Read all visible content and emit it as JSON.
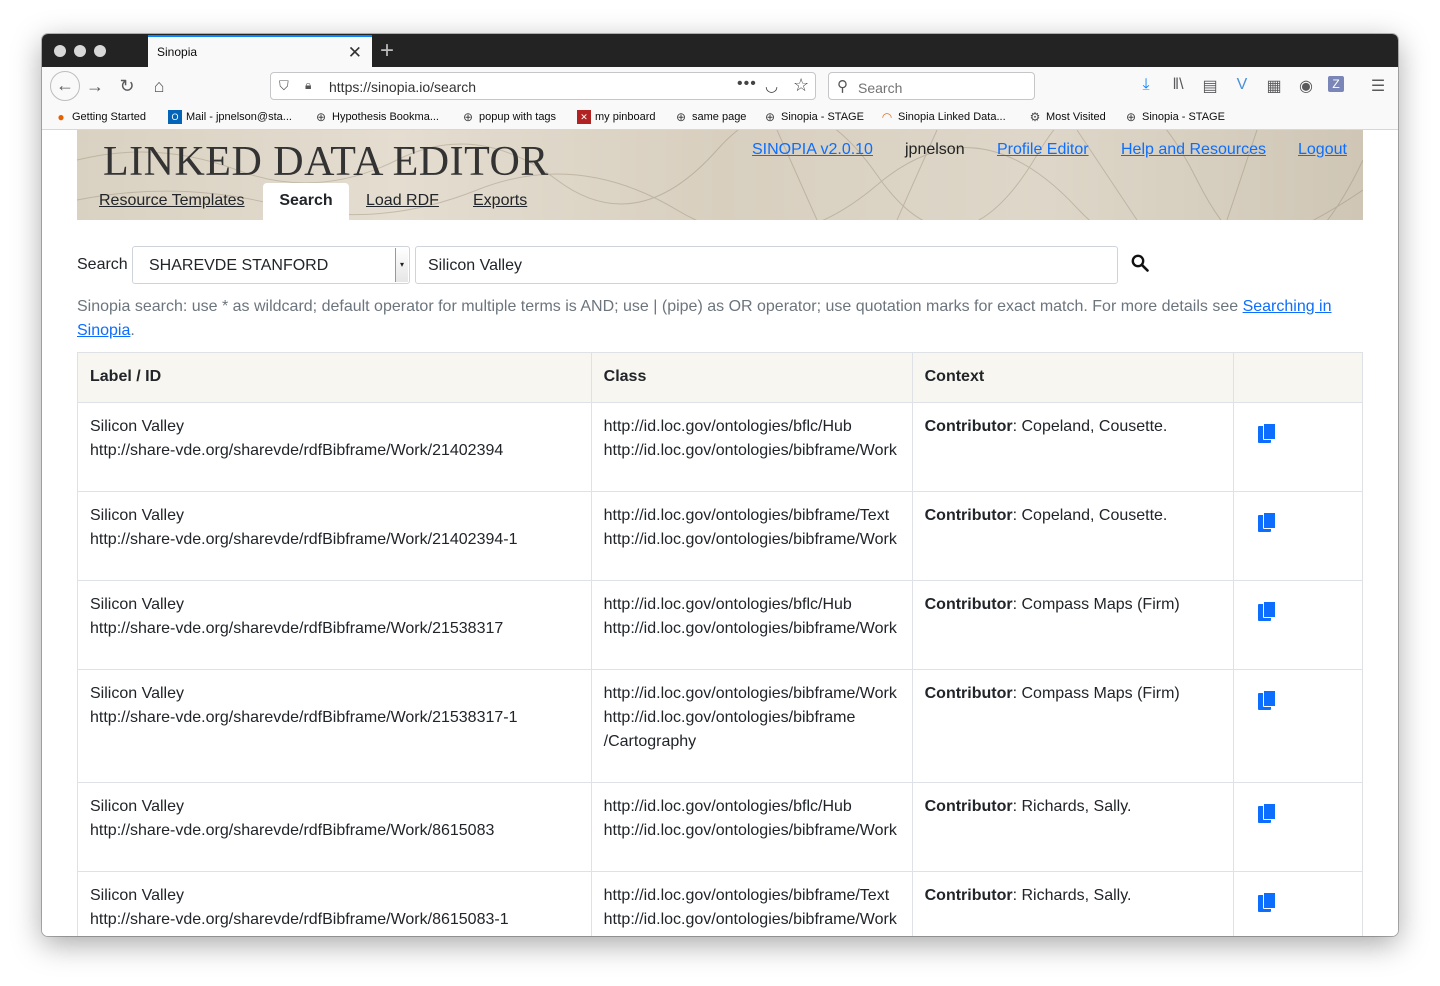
{
  "browser": {
    "tab_title": "Sinopia",
    "url": "https://sinopia.io/search",
    "search_placeholder": "Search",
    "bookmarks": [
      {
        "label": "Getting Started",
        "icon": "firefox-icon"
      },
      {
        "label": "Mail - jpnelson@sta...",
        "icon": "outlook-icon"
      },
      {
        "label": "Hypothesis Bookma...",
        "icon": "globe-icon"
      },
      {
        "label": "popup with tags",
        "icon": "globe-icon"
      },
      {
        "label": "my pinboard",
        "icon": "pinboard-icon"
      },
      {
        "label": "same page",
        "icon": "globe-icon"
      },
      {
        "label": "Sinopia - STAGE",
        "icon": "globe-icon"
      },
      {
        "label": "Sinopia Linked Data...",
        "icon": "sinopia-icon"
      },
      {
        "label": "Most Visited",
        "icon": "gear-icon"
      },
      {
        "label": "Sinopia - STAGE",
        "icon": "globe-icon"
      }
    ]
  },
  "header": {
    "title": "LINKED DATA EDITOR",
    "version_link": "SINOPIA v2.0.10",
    "username": "jpnelson",
    "profile_link": "Profile Editor",
    "help_link": "Help and Resources",
    "logout_link": "Logout",
    "tabs": [
      "Resource Templates",
      "Search",
      "Load RDF",
      "Exports"
    ]
  },
  "search": {
    "label": "Search",
    "scope": "SHAREVDE STANFORD",
    "query": "Silicon Valley",
    "help_text": "Sinopia search: use * as wildcard; default operator for multiple terms is AND; use | (pipe) as OR operator; use quotation marks for exact match. For more details see ",
    "help_link": "Searching in Sinopia",
    "help_end": "."
  },
  "table": {
    "headers": [
      "Label / ID",
      "Class",
      "Context",
      ""
    ],
    "context_key": "Contributor",
    "rows": [
      {
        "label": "Silicon Valley",
        "id": "http://share-vde.org/sharevde/rdfBibframe/Work/21402394",
        "class1": "http://id.loc.gov/ontologies/bflc/Hub",
        "class2": "http://id.loc.gov/ontologies/bibframe/Work",
        "class3": "",
        "context": ": Copeland, Cousette."
      },
      {
        "label": "Silicon Valley",
        "id": "http://share-vde.org/sharevde/rdfBibframe/Work/21402394-1",
        "class1": "http://id.loc.gov/ontologies/bibframe/Text",
        "class2": "http://id.loc.gov/ontologies/bibframe/Work",
        "class3": "",
        "context": ": Copeland, Cousette."
      },
      {
        "label": "Silicon Valley",
        "id": "http://share-vde.org/sharevde/rdfBibframe/Work/21538317",
        "class1": "http://id.loc.gov/ontologies/bflc/Hub",
        "class2": "http://id.loc.gov/ontologies/bibframe/Work",
        "class3": "",
        "context": ": Compass Maps (Firm)"
      },
      {
        "label": "Silicon Valley",
        "id": "http://share-vde.org/sharevde/rdfBibframe/Work/21538317-1",
        "class1": "http://id.loc.gov/ontologies/bibframe/Work",
        "class2": "http://id.loc.gov/ontologies/bibframe",
        "class3": "/Cartography",
        "context": ": Compass Maps (Firm)"
      },
      {
        "label": "Silicon Valley",
        "id": "http://share-vde.org/sharevde/rdfBibframe/Work/8615083",
        "class1": "http://id.loc.gov/ontologies/bflc/Hub",
        "class2": "http://id.loc.gov/ontologies/bibframe/Work",
        "class3": "",
        "context": ": Richards, Sally."
      },
      {
        "label": "Silicon Valley",
        "id": "http://share-vde.org/sharevde/rdfBibframe/Work/8615083-1",
        "class1": "http://id.loc.gov/ontologies/bibframe/Text",
        "class2": "http://id.loc.gov/ontologies/bibframe/Work",
        "class3": "",
        "context": ": Richards, Sally."
      }
    ]
  },
  "colors": {
    "link": "#0d6efd",
    "header_bg": "#f8f6f0"
  }
}
